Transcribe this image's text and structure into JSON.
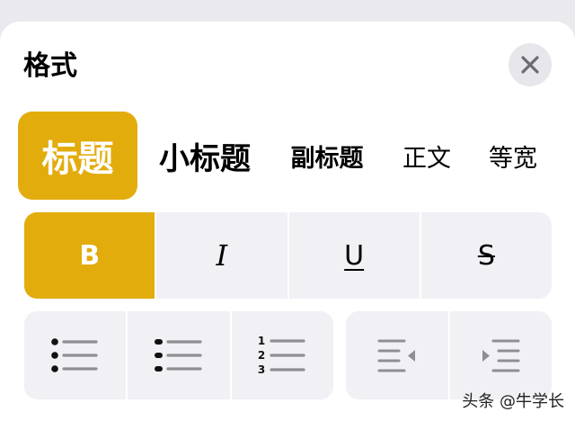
{
  "sheet": {
    "title": "格式"
  },
  "text_styles": [
    {
      "label": "标题",
      "selected": true
    },
    {
      "label": "小标题",
      "selected": false
    },
    {
      "label": "副标题",
      "selected": false
    },
    {
      "label": "正文",
      "selected": false
    },
    {
      "label": "等宽",
      "selected": false
    }
  ],
  "format_buttons": [
    {
      "label": "B",
      "name": "bold",
      "active": true
    },
    {
      "label": "I",
      "name": "italic",
      "active": false
    },
    {
      "label": "U",
      "name": "underline",
      "active": false
    },
    {
      "label": "S",
      "name": "strikethrough",
      "active": false
    }
  ],
  "list_buttons": [
    "bulleted-list-icon",
    "dashed-list-icon",
    "numbered-list-icon"
  ],
  "numbered_list_digits": [
    "1",
    "2",
    "3"
  ],
  "indent_buttons": [
    "decrease-indent-icon",
    "increase-indent-icon"
  ],
  "watermark": "头条 @牛学长",
  "colors": {
    "accent": "#e2ac0d",
    "panel": "#f1f1f5",
    "close_bg": "#e6e6eb"
  }
}
